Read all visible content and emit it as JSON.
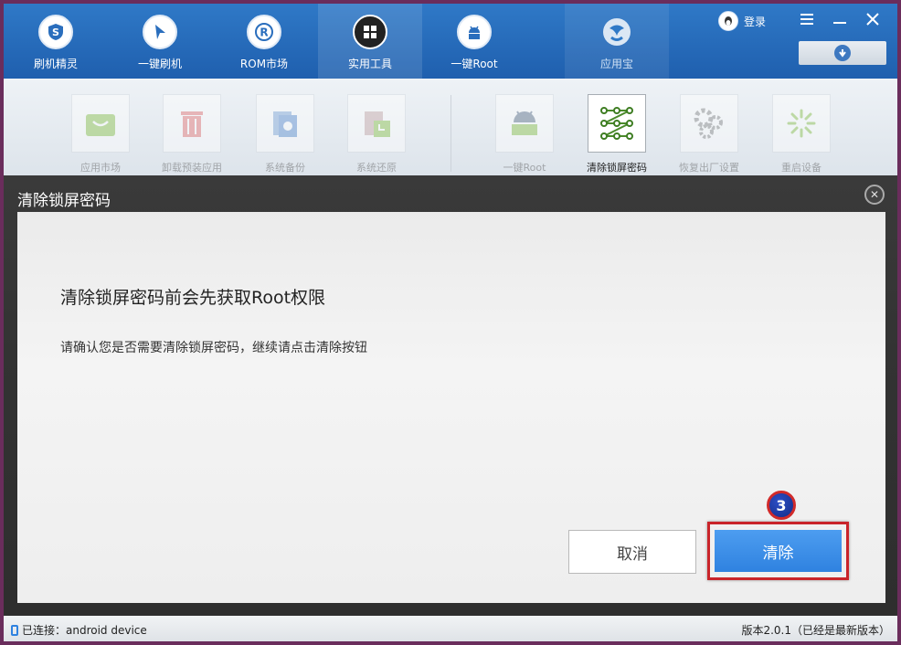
{
  "nav": {
    "items": [
      {
        "label": "刷机精灵",
        "icon": "shield-s-icon"
      },
      {
        "label": "一键刷机",
        "icon": "cursor-icon"
      },
      {
        "label": "ROM市场",
        "icon": "rom-r-icon"
      },
      {
        "label": "实用工具",
        "icon": "grid-icon"
      },
      {
        "label": "一键Root",
        "icon": "android-icon"
      }
    ],
    "app_store": {
      "label": "应用宝",
      "icon": "yingyongbao-icon"
    },
    "login_label": "登录"
  },
  "tools": [
    {
      "label": "应用市场",
      "icon": "shopping-bag-icon"
    },
    {
      "label": "卸载预装应用",
      "icon": "trash-icon"
    },
    {
      "label": "系统备份",
      "icon": "backup-icon"
    },
    {
      "label": "系统还原",
      "icon": "restore-icon"
    },
    {
      "label": "一键Root",
      "icon": "android-root-icon"
    },
    {
      "label": "清除锁屏密码",
      "icon": "pattern-lock-icon"
    },
    {
      "label": "恢复出厂设置",
      "icon": "gears-icon"
    },
    {
      "label": "重启设备",
      "icon": "loading-icon"
    }
  ],
  "dialog": {
    "title": "清除锁屏密码",
    "heading": "清除锁屏密码前会先获取Root权限",
    "message": "请确认您是否需要清除锁屏密码，继续请点击清除按钮",
    "cancel_label": "取消",
    "confirm_label": "清除",
    "step_badge": "3"
  },
  "status": {
    "connection": "已连接：android device",
    "version": "版本2.0.1（已经是最新版本）"
  },
  "colors": {
    "topbar": "#2f79c7",
    "primary_button": "#2f82e0",
    "highlight": "#c9242a"
  }
}
